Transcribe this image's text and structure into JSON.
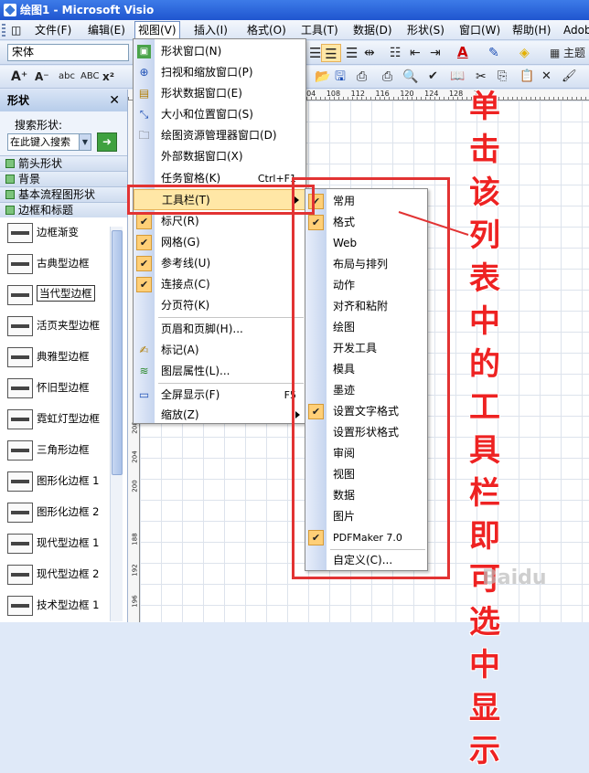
{
  "window": {
    "title": "绘图1 - Microsoft Visio"
  },
  "menubar": {
    "items": [
      "文件(F)",
      "编辑(E)",
      "视图(V)",
      "插入(I)",
      "格式(O)",
      "工具(T)",
      "数据(D)",
      "形状(S)",
      "窗口(W)",
      "帮助(H)",
      "Adobe"
    ]
  },
  "format_toolbar": {
    "font": "宋体",
    "small_caps": "ABC",
    "theme_label": "主题"
  },
  "shapes_panel": {
    "title": "形状",
    "search_label": "搜索形状:",
    "search_placeholder": "在此键入搜索",
    "stencils": [
      "箭头形状",
      "背景",
      "基本流程图形状",
      "边框和标题"
    ],
    "items": [
      "边框渐变",
      "古典型边框",
      "当代型边框",
      "活页夹型边框",
      "典雅型边框",
      "怀旧型边框",
      "霓虹灯型边框",
      "三角形边框",
      "图形化边框 1",
      "图形化边框 2",
      "现代型边框 1",
      "现代型边框 2",
      "技术型边框 1"
    ]
  },
  "ruler": {
    "top": [
      "104",
      "108",
      "112",
      "116",
      "120",
      "124",
      "128",
      "1"
    ],
    "left": [
      "188",
      "192",
      "196",
      "200",
      "204",
      "208"
    ]
  },
  "view_menu": {
    "items": [
      {
        "label": "形状窗口(N)",
        "shortcut": "",
        "icon": "shapes-window-icon",
        "checked": false
      },
      {
        "label": "扫视和缩放窗口(P)",
        "shortcut": "",
        "icon": "pan-zoom-icon",
        "checked": false
      },
      {
        "label": "形状数据窗口(E)",
        "shortcut": "",
        "icon": "shape-data-icon",
        "checked": false
      },
      {
        "label": "大小和位置窗口(S)",
        "shortcut": "",
        "icon": "size-position-icon",
        "checked": false
      },
      {
        "label": "绘图资源管理器窗口(D)",
        "shortcut": "",
        "icon": "drawing-explorer-icon",
        "checked": false
      },
      {
        "label": "外部数据窗口(X)",
        "shortcut": "",
        "icon": "",
        "checked": false
      },
      {
        "label": "任务窗格(K)",
        "shortcut": "Ctrl+F1",
        "icon": "",
        "checked": false
      },
      {
        "label": "工具栏(T)",
        "shortcut": "",
        "icon": "",
        "checked": false,
        "submenu": true
      },
      {
        "label": "标尺(R)",
        "shortcut": "",
        "icon": "",
        "checked": true
      },
      {
        "label": "网格(G)",
        "shortcut": "",
        "icon": "",
        "checked": true
      },
      {
        "label": "参考线(U)",
        "shortcut": "",
        "icon": "",
        "checked": true
      },
      {
        "label": "连接点(C)",
        "shortcut": "",
        "icon": "",
        "checked": true
      },
      {
        "label": "分页符(K)",
        "shortcut": "",
        "icon": "",
        "checked": false
      },
      {
        "label": "页眉和页脚(H)...",
        "shortcut": "",
        "icon": "",
        "checked": false
      },
      {
        "label": "标记(A)",
        "shortcut": "",
        "icon": "markup-icon",
        "checked": false
      },
      {
        "label": "图层属性(L)...",
        "shortcut": "",
        "icon": "layers-icon",
        "checked": false
      },
      {
        "label": "全屏显示(F)",
        "shortcut": "F5",
        "icon": "fullscreen-icon",
        "checked": false
      },
      {
        "label": "缩放(Z)",
        "shortcut": "",
        "icon": "",
        "checked": false
      }
    ]
  },
  "toolbar_submenu": {
    "items": [
      {
        "label": "常用",
        "checked": true
      },
      {
        "label": "格式",
        "checked": true
      },
      {
        "label": "Web",
        "checked": false
      },
      {
        "label": "布局与排列",
        "checked": false
      },
      {
        "label": "动作",
        "checked": false
      },
      {
        "label": "对齐和粘附",
        "checked": false
      },
      {
        "label": "绘图",
        "checked": false
      },
      {
        "label": "开发工具",
        "checked": false
      },
      {
        "label": "模具",
        "checked": false
      },
      {
        "label": "墨迹",
        "checked": false
      },
      {
        "label": "设置文字格式",
        "checked": true
      },
      {
        "label": "设置形状格式",
        "checked": false
      },
      {
        "label": "审阅",
        "checked": false
      },
      {
        "label": "视图",
        "checked": false
      },
      {
        "label": "数据",
        "checked": false
      },
      {
        "label": "图片",
        "checked": false
      },
      {
        "label": "PDFMaker 7.0",
        "checked": true
      },
      {
        "label": "自定义(C)...",
        "checked": false
      }
    ]
  },
  "annotation": {
    "text": "单击该列表中的工具栏即可选中显示",
    "color": "#ee2222"
  },
  "watermark": "Baidu"
}
